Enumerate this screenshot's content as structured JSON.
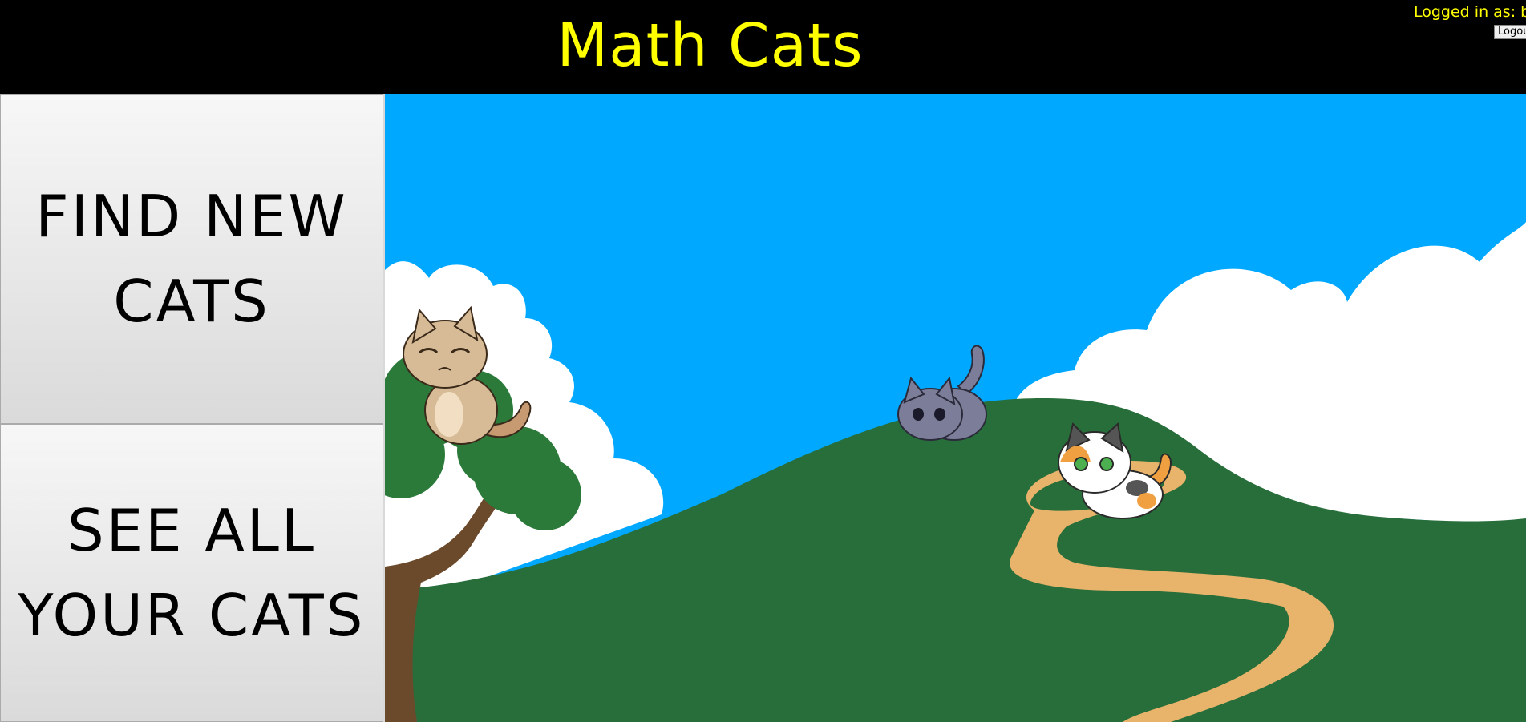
{
  "header": {
    "title": "Math Cats",
    "login_text": "Logged in as: bo",
    "logout_label": "Logout"
  },
  "nav": {
    "find_new_cats": "FIND NEW CATS",
    "see_all_cats": "SEE ALL YOUR CATS"
  },
  "scene": {
    "sky_color": "#00a8ff",
    "grass_color": "#276e3b",
    "path_color": "#e8b36b",
    "cats": [
      {
        "name": "tabby-cat",
        "color": "#d6bb96"
      },
      {
        "name": "gray-cat",
        "color": "#7c7e99"
      },
      {
        "name": "calico-cat",
        "color": "#ffffff"
      }
    ]
  }
}
